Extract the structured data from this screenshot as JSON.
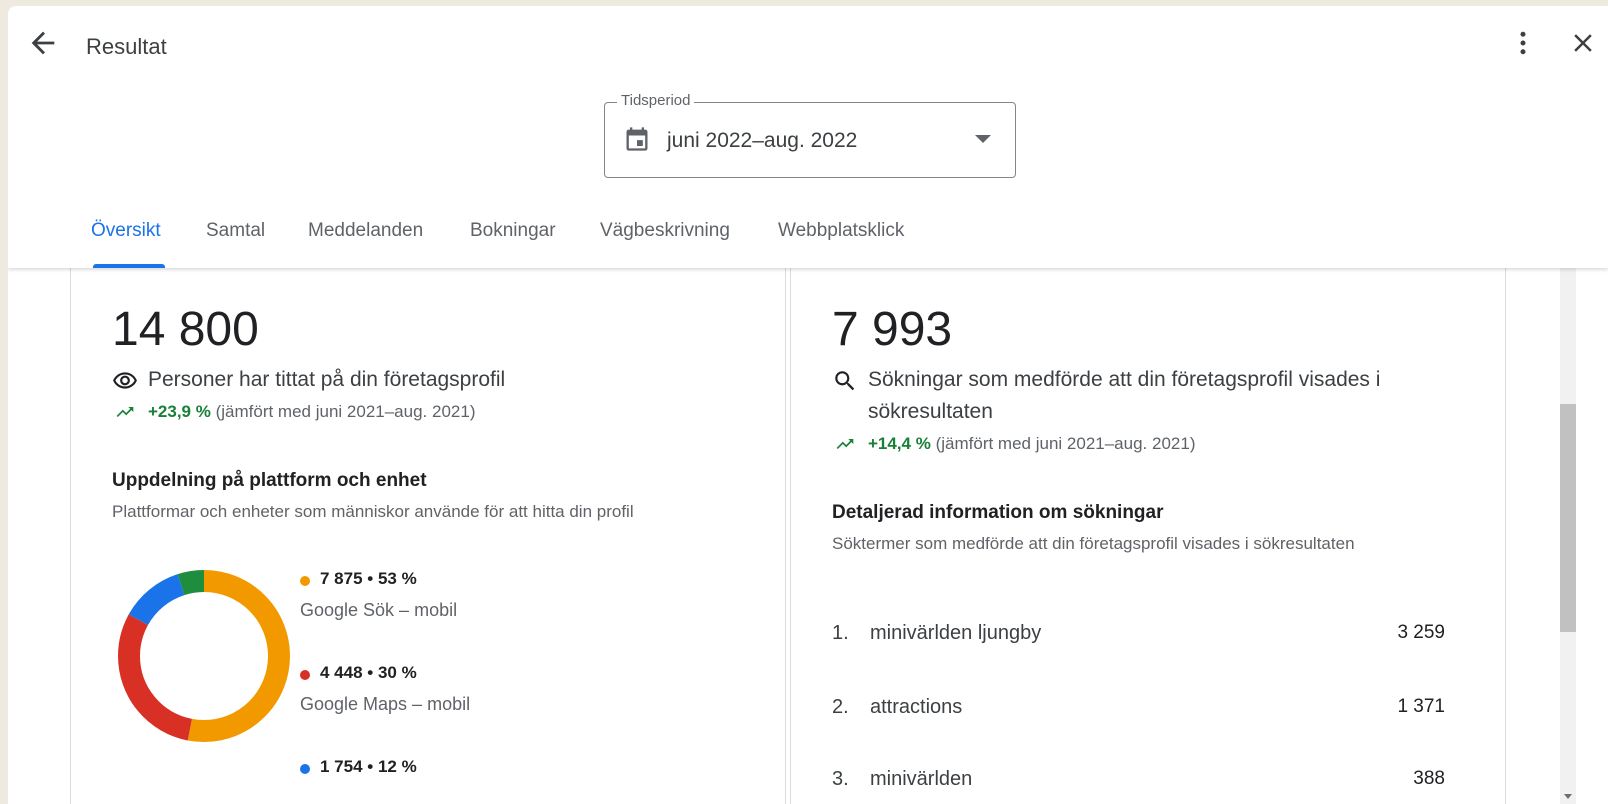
{
  "header": {
    "title": "Resultat"
  },
  "period": {
    "label": "Tidsperiod",
    "value": "juni 2022–aug. 2022"
  },
  "tabs": [
    {
      "label": "Översikt",
      "active": true
    },
    {
      "label": "Samtal"
    },
    {
      "label": "Meddelanden"
    },
    {
      "label": "Bokningar"
    },
    {
      "label": "Vägbeskrivning"
    },
    {
      "label": "Webbplatsklick"
    }
  ],
  "profile_views": {
    "total": "14 800",
    "description": "Personer har tittat på din företagsprofil",
    "change": "+23,9 %",
    "comparison": "(jämfört med juni 2021–aug. 2021)",
    "icon": "eye-icon"
  },
  "platform_breakdown": {
    "title": "Uppdelning på plattform och enhet",
    "subtitle": "Plattformar och enheter som människor använde för att hitta din profil",
    "items": [
      {
        "value": "7 875 • 53 %",
        "name": "Google Sök – mobil",
        "color": "#f29900",
        "share": 53
      },
      {
        "value": "4 448 • 30 %",
        "name": "Google Maps – mobil",
        "color": "#d93025",
        "share": 30
      },
      {
        "value": "1 754 • 12 %",
        "name": "",
        "color": "#1a73e8",
        "share": 12
      },
      {
        "value": "",
        "name": "",
        "color": "#1e8e3e",
        "share": 5
      }
    ]
  },
  "searches": {
    "total": "7 993",
    "description_line1": "Sökningar som medförde att din företagsprofil visades i",
    "description_line2": "sökresultaten",
    "change": "+14,4 %",
    "comparison": "(jämfört med juni 2021–aug. 2021)",
    "icon": "search-icon"
  },
  "search_details": {
    "title": "Detaljerad information om sökningar",
    "subtitle": "Söktermer som medförde att din företagsprofil visades i sökresultaten",
    "rows": [
      {
        "index": "1.",
        "term": "minivärlden ljungby",
        "count": "3 259"
      },
      {
        "index": "2.",
        "term": "attractions",
        "count": "1 371"
      },
      {
        "index": "3.",
        "term": "minivärlden",
        "count": "388"
      }
    ]
  },
  "colors": {
    "accent": "#1a73e8",
    "positive": "#188038"
  }
}
